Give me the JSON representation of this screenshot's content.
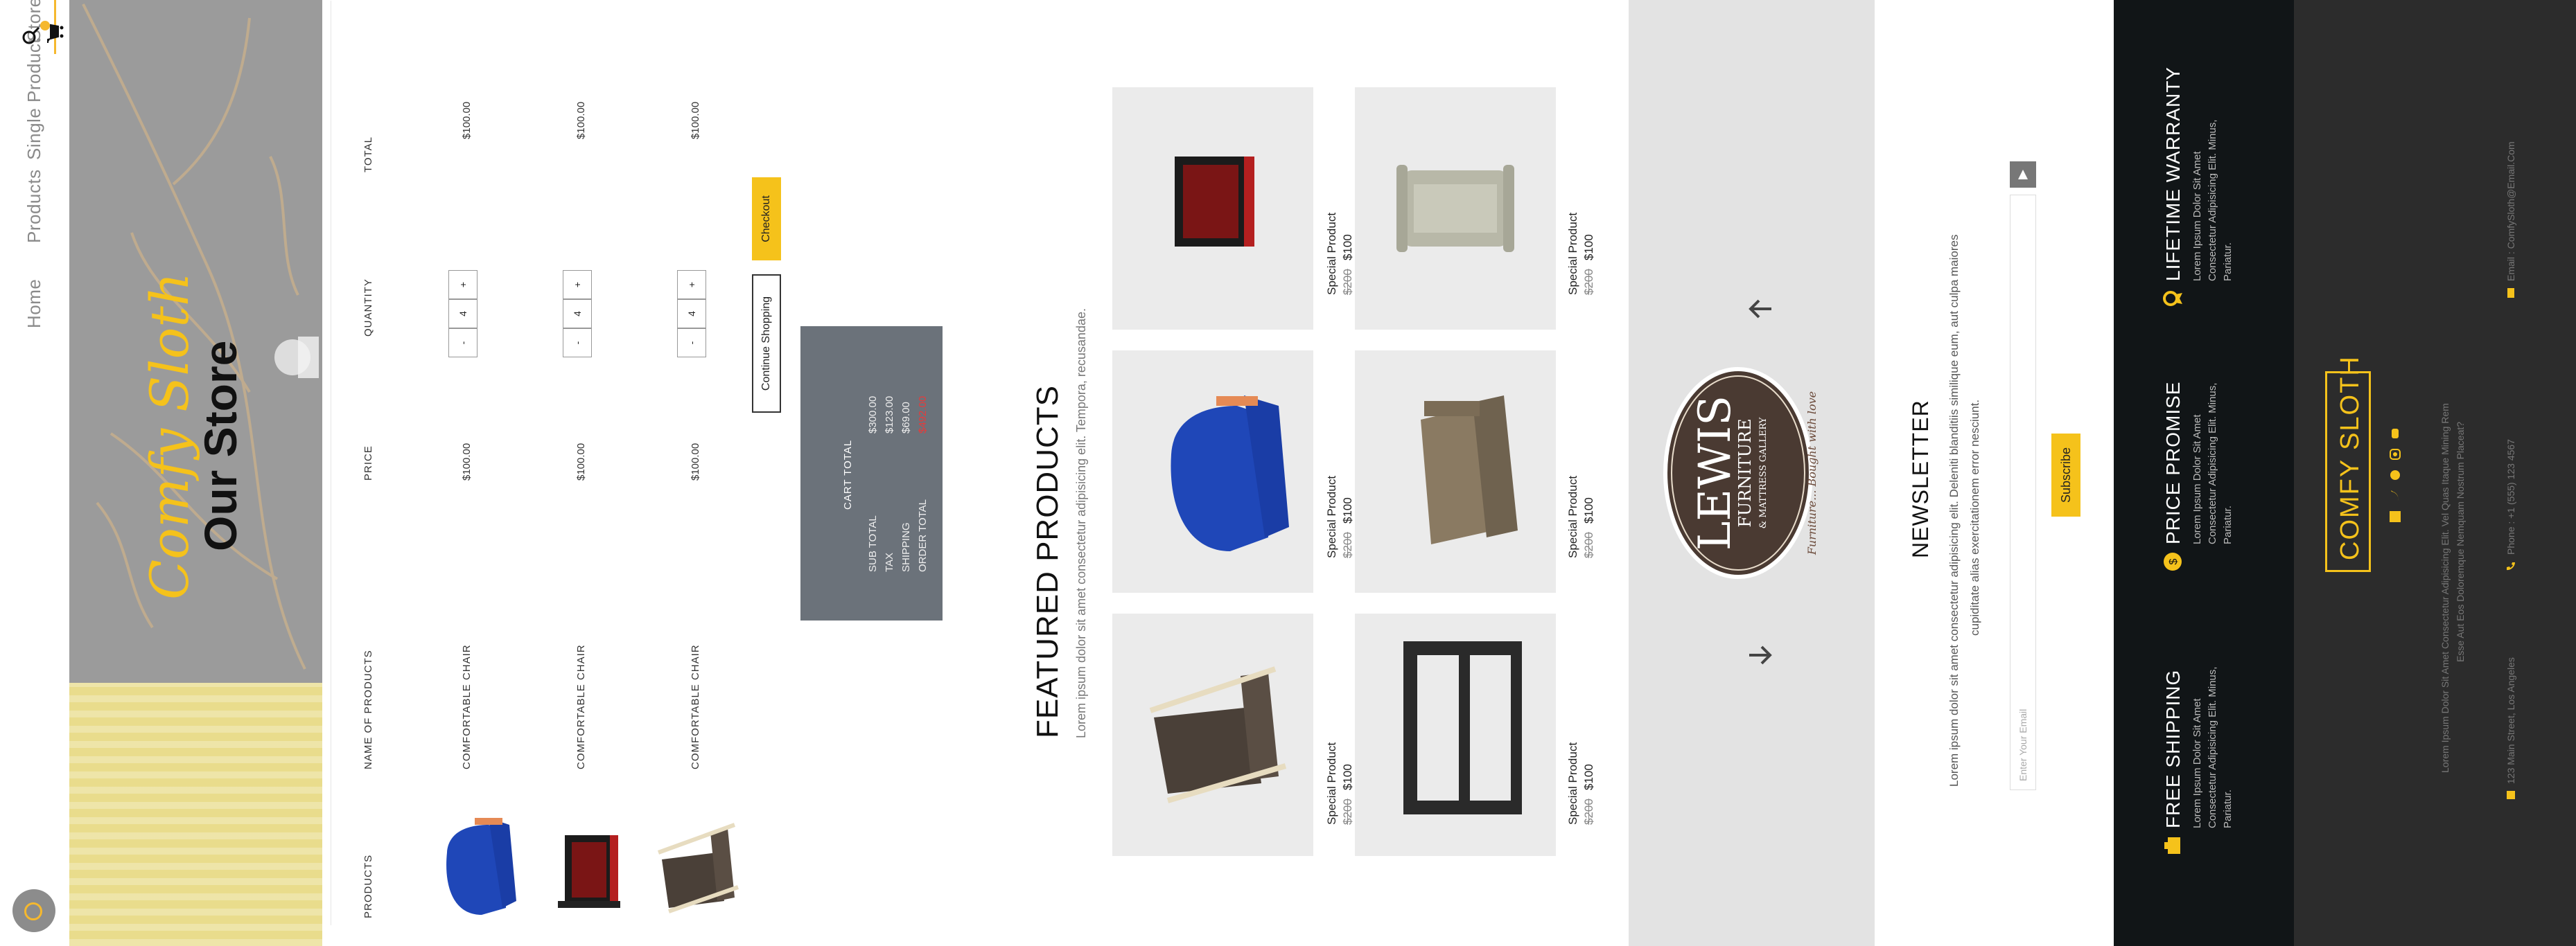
{
  "nav": {
    "items": [
      "Home",
      "Products",
      "Single Product",
      "Store"
    ],
    "active": "Store"
  },
  "hero": {
    "script_title": "Comfy Sloth",
    "title": "Our Store"
  },
  "cart": {
    "columns": [
      "PRODUCTS",
      "NAME OF PRODUCTS",
      "PRICE",
      "QUANTITY",
      "TOTAL"
    ],
    "rows": [
      {
        "name": "COMFORTABLE CHAIR",
        "price": "$100.00",
        "qty": "4",
        "total": "$100.00",
        "product": "blue-sofa"
      },
      {
        "name": "COMFORTABLE CHAIR",
        "price": "$100.00",
        "qty": "4",
        "total": "$100.00",
        "product": "red-armchair"
      },
      {
        "name": "COMFORTABLE CHAIR",
        "price": "$100.00",
        "qty": "4",
        "total": "$100.00",
        "product": "lounge-chair"
      }
    ],
    "minus": "-",
    "plus": "+",
    "continue": "Continue Shopping",
    "checkout": "Checkout",
    "summary": {
      "title": "CART TOTAL",
      "subtotal_label": "SUB TOTAL",
      "tax_label": "TAX",
      "shipping_label": "SHIPPING",
      "order_label": "ORDER TOTAL",
      "subtotal": "$300.00",
      "tax": "$123.00",
      "shipping": "$69.00",
      "order": "$492.00"
    }
  },
  "featured": {
    "title": "FEATURED PRODUCTS",
    "subtitle": "Lorem ipsum dolor sit amet consectetur adipisicing elit. Tempora, recusandae.",
    "cards": [
      {
        "name": "Special Product",
        "old": "$200",
        "price": "$100",
        "product": "lounge-chair"
      },
      {
        "name": "Special Product",
        "old": "$200",
        "price": "$100",
        "product": "blue-sofa"
      },
      {
        "name": "Special Product",
        "old": "$200",
        "price": "$100",
        "product": "red-armchair"
      },
      {
        "name": "Special Product",
        "old": "$200",
        "price": "$100",
        "product": "shelf"
      },
      {
        "name": "Special Product",
        "old": "$200",
        "price": "$100",
        "product": "brown-sofa"
      },
      {
        "name": "Special Product",
        "old": "$200",
        "price": "$100",
        "product": "grey-sofa"
      }
    ]
  },
  "brand": {
    "logo_main": "LEWIS",
    "logo_sub1": "FURNITURE",
    "logo_sub2": "& MATTRESS GALLERY",
    "logo_tagline": "Furniture... Bought with love"
  },
  "newsletter": {
    "title": "NEWSLETTER",
    "text1": "Lorem ipsum dolor sit amet consectetur adipisicing elit. Deleniti blanditiis similique eum, aut culpa maiores",
    "text2": "cupiditate alias exercitationem error nesciunt.",
    "placeholder": "Enter Your Email",
    "button": "Subscribe"
  },
  "features": [
    {
      "title": "FREE SHIPPING",
      "text": "Lorem Ipsum Dolor Sit Amet Consectetur Adipisicing Elit. Minus, Pariatur.",
      "icon": "box-icon"
    },
    {
      "title": "PRICE PROMISE",
      "text": "Lorem Ipsum Dolor Sit Amet Consectetur Adipisicing Elit. Minus, Pariatur.",
      "icon": "dollar-icon"
    },
    {
      "title": "LIFETIME WARRANTY",
      "text": "Lorem Ipsum Dolor Sit Amet Consectetur Adipisicing Elit. Minus, Pariatur.",
      "icon": "award-icon"
    }
  ],
  "footer": {
    "logo": "COMFY SLOTH",
    "about1": "Lorem Ipsum Dolor Sit Amet Consectetur Adipisicing Elit. Vel Quas Itaque Mining Rem",
    "about2": "Esse Aut Eos Doloremque Nemquam Nostrum Placeat?",
    "address": "123 Main Street, Los Angeles",
    "phone": "Phone : +1 (555) 123 4567",
    "email": "Email : ComfySloth@Email.Com",
    "social": [
      "facebook-icon",
      "twitter-icon",
      "pinterest-icon",
      "instagram-icon",
      "youtube-icon"
    ]
  },
  "colors": {
    "accent": "#f5c21b",
    "dark": "#111517",
    "footer": "#2c2c2c",
    "summary": "#6b727a"
  }
}
